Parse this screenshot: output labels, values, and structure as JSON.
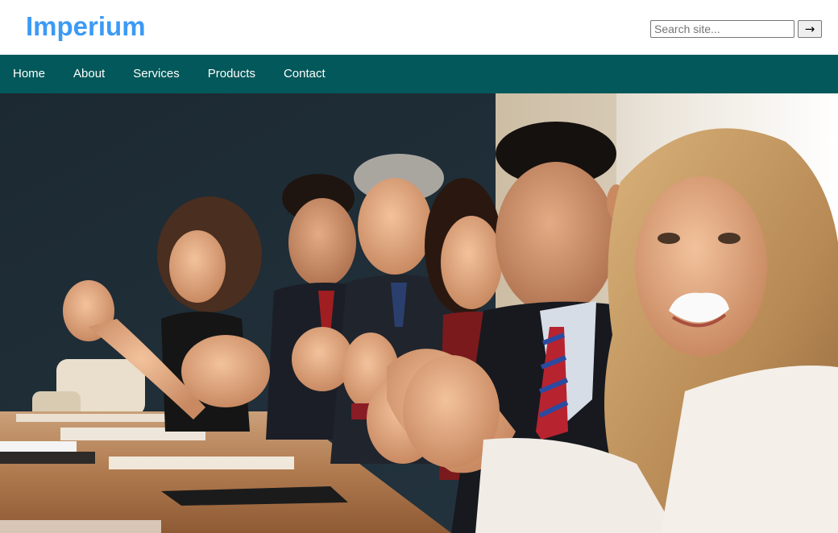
{
  "site": {
    "logo": "Imperium"
  },
  "search": {
    "placeholder": "Search site...",
    "button_label": "→"
  },
  "nav": {
    "items": [
      {
        "label": "Home"
      },
      {
        "label": "About"
      },
      {
        "label": "Services"
      },
      {
        "label": "Products"
      },
      {
        "label": "Contact"
      }
    ]
  },
  "hero": {
    "image": "business-team-applauding-photo"
  },
  "colors": {
    "logo": "#3c9af5",
    "nav_background": "#02585a",
    "nav_text": "#ffffff"
  }
}
